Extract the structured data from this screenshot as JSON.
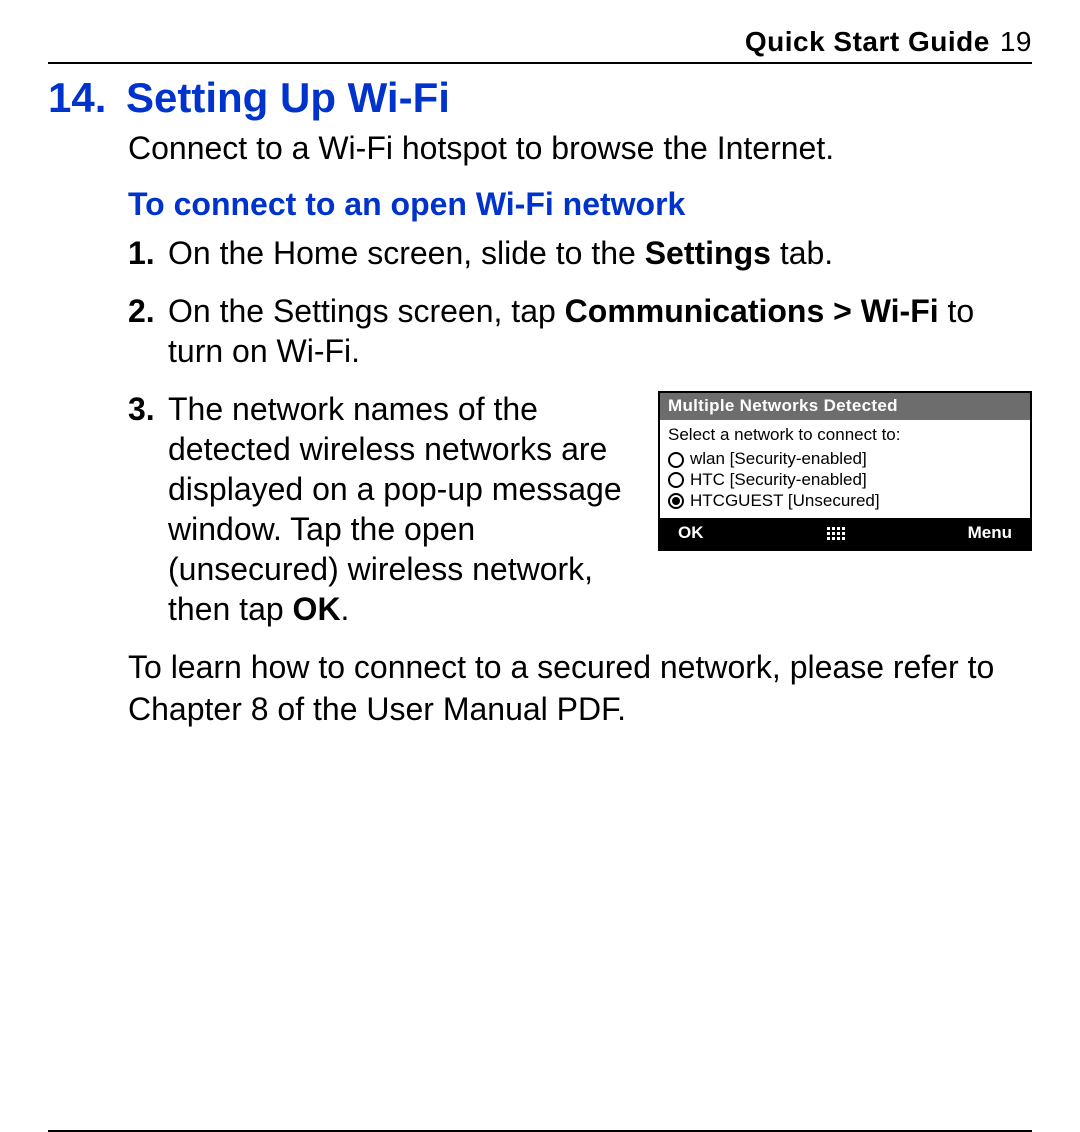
{
  "header": {
    "label": "Quick Start Guide",
    "page": "19"
  },
  "section": {
    "number": "14.",
    "title": "Setting Up Wi-Fi"
  },
  "intro": "Connect to a Wi-Fi hotspot to browse the Internet.",
  "subhead": "To connect to an open Wi-Fi network",
  "steps": {
    "s1": {
      "num": "1.",
      "pre": "On the Home screen, slide to the ",
      "bold": "Settings",
      "post": " tab."
    },
    "s2": {
      "num": "2.",
      "pre": "On the Settings screen, tap ",
      "bold": "Communications > Wi-Fi",
      "post": " to turn on Wi-Fi."
    },
    "s3": {
      "num": "3.",
      "pre": "The network names of the detected wireless networks are displayed on a pop-up message window. Tap the open (unsecured) wireless network, then tap ",
      "bold": "OK",
      "post": "."
    }
  },
  "device": {
    "title": "Multiple Networks Detected",
    "prompt": "Select a network to connect to:",
    "networks": [
      {
        "label": "wlan [Security-enabled]",
        "selected": false
      },
      {
        "label": "HTC [Security-enabled]",
        "selected": false
      },
      {
        "label": "HTCGUEST [Unsecured]",
        "selected": true
      }
    ],
    "ok": "OK",
    "menu": "Menu"
  },
  "closing": "To learn how to connect to a secured network, please refer to Chapter 8 of the User Manual PDF."
}
